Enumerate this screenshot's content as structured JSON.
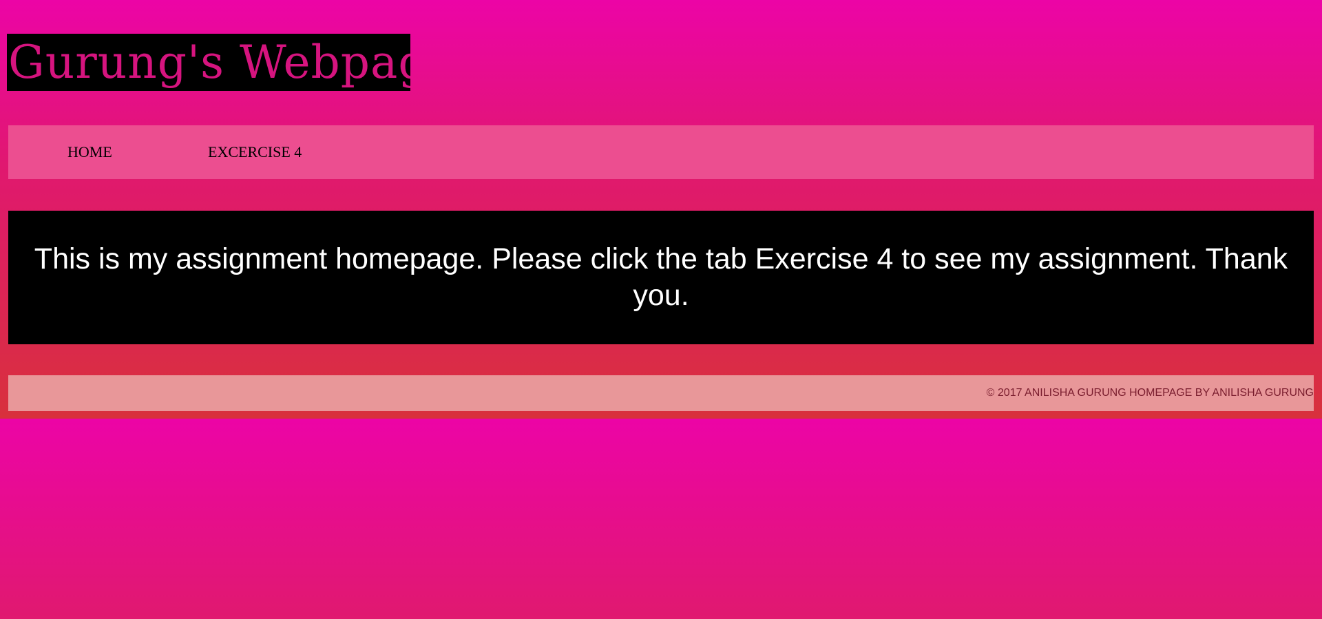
{
  "header": {
    "title": "Gurung's Webpage"
  },
  "nav": {
    "items": [
      {
        "label": "HOME"
      },
      {
        "label": "EXCERCISE 4"
      }
    ]
  },
  "main": {
    "message": "This is my assignment homepage. Please click the tab Exercise 4 to see my assignment. Thank you."
  },
  "footer": {
    "text": "© 2017 ANILISHA GURUNG HOMEPAGE BY ANILISHA GURUNG"
  },
  "colors": {
    "title_text": "#d6147f",
    "title_bg": "#000000",
    "nav_bg": "#ec4e90",
    "content_bg": "#000000",
    "content_text": "#ffffff",
    "footer_bg": "#e89799",
    "footer_text": "#7a1d2e",
    "page_bg": "#ec04a6"
  }
}
